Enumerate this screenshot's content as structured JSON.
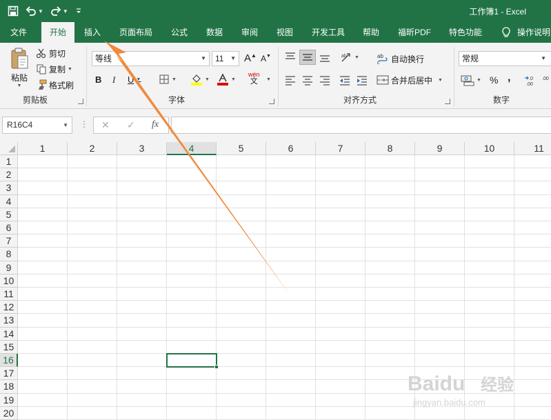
{
  "window": {
    "title": "工作簿1  -  Excel"
  },
  "qat": {
    "save": "save-icon",
    "undo": "undo-icon",
    "redo": "redo-icon",
    "customize": "customize-icon"
  },
  "tabs": [
    {
      "label": "文件",
      "active": false
    },
    {
      "label": "开始",
      "active": true
    },
    {
      "label": "插入",
      "active": false
    },
    {
      "label": "页面布局",
      "active": false
    },
    {
      "label": "公式",
      "active": false
    },
    {
      "label": "数据",
      "active": false
    },
    {
      "label": "审阅",
      "active": false
    },
    {
      "label": "视图",
      "active": false
    },
    {
      "label": "开发工具",
      "active": false
    },
    {
      "label": "帮助",
      "active": false
    },
    {
      "label": "福昕PDF",
      "active": false
    },
    {
      "label": "特色功能",
      "active": false
    },
    {
      "label": "操作说明",
      "active": false
    }
  ],
  "clipboard": {
    "paste": "粘贴",
    "cut": "剪切",
    "copy": "复制",
    "format_painter": "格式刷",
    "group": "剪贴板"
  },
  "font": {
    "name": "等线",
    "size": "11",
    "bold": "B",
    "italic": "I",
    "underline": "U",
    "grow": "A",
    "shrink": "A",
    "phonetic": "wén",
    "group": "字体",
    "fill_color": "#ffff00",
    "font_color": "#e00000"
  },
  "alignment": {
    "wrap_text": "自动换行",
    "merge_center": "合并后居中",
    "group": "对齐方式"
  },
  "number": {
    "format": "常规",
    "percent": "%",
    "comma": ",",
    "group": "数字"
  },
  "formula_bar": {
    "name_box": "R16C4",
    "fx": "fx",
    "cancel": "✕",
    "enter": "✓",
    "value": ""
  },
  "sheet": {
    "columns": [
      "1",
      "2",
      "3",
      "4",
      "5",
      "6",
      "7",
      "8",
      "9",
      "10",
      "11"
    ],
    "rows": [
      "1",
      "2",
      "3",
      "4",
      "5",
      "6",
      "7",
      "8",
      "9",
      "10",
      "11",
      "12",
      "13",
      "14",
      "15",
      "16",
      "17",
      "18",
      "19",
      "20"
    ],
    "selected_column": "4",
    "selected_row": "16",
    "accent": "#217346"
  },
  "watermark": {
    "brand": "Baidu",
    "cn": "经验",
    "url": "jingyan.baidu.com"
  },
  "annotation": {
    "color": "#f08a3c"
  }
}
